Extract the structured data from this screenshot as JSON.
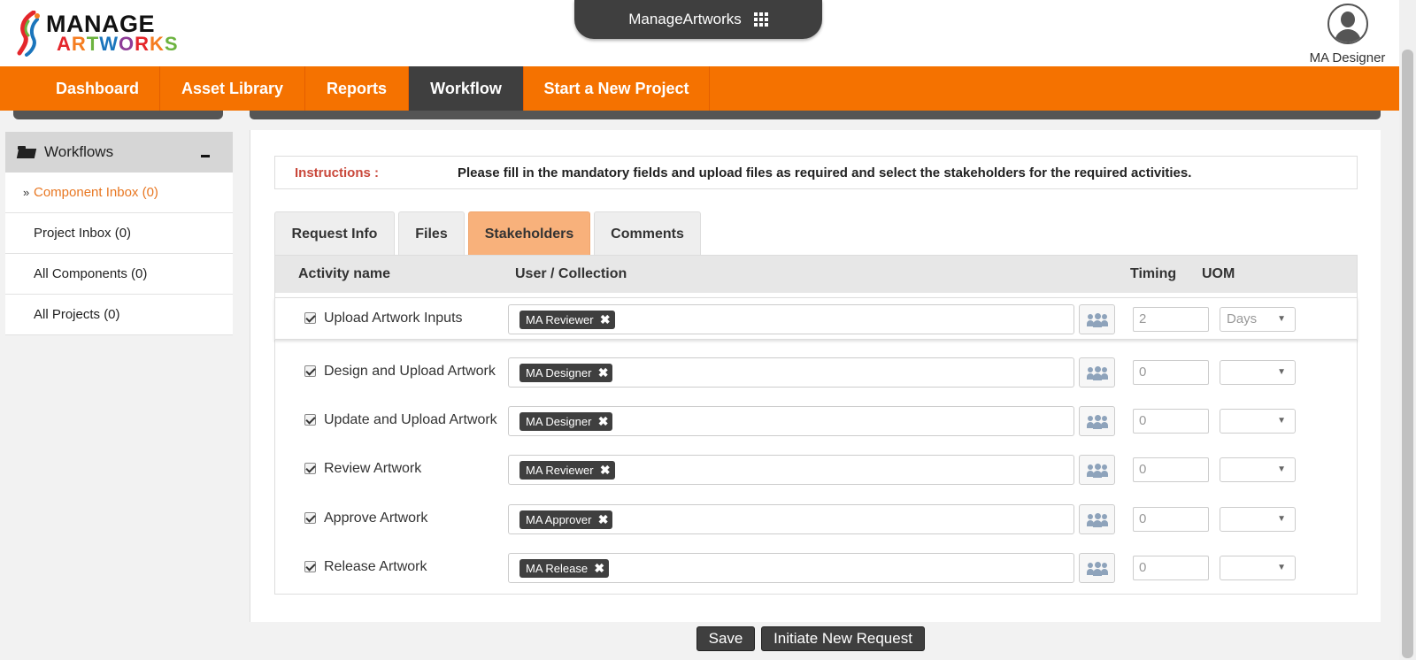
{
  "header": {
    "logo_line1": "MANAGE",
    "logo_line2_letters": [
      "A",
      "R",
      "T",
      "W",
      "O",
      "R",
      "K",
      "S"
    ],
    "logo_colors": [
      "#e4262b",
      "#f57d20",
      "#6cb33f",
      "#1b75bc",
      "#8e3c97",
      "#e4262b",
      "#f57d20",
      "#6cb33f"
    ],
    "app_name": "ManageArtworks",
    "user_name": "MA Designer"
  },
  "nav": {
    "items": [
      {
        "label": "Dashboard"
      },
      {
        "label": "Asset Library"
      },
      {
        "label": "Reports"
      },
      {
        "label": "Workflow",
        "active": true
      },
      {
        "label": "Start a New Project"
      }
    ]
  },
  "sidebar": {
    "header": "Workflows",
    "items": [
      {
        "label": "Component Inbox (0)",
        "active": true
      },
      {
        "label": "Project Inbox (0)"
      },
      {
        "label": "All Components (0)"
      },
      {
        "label": "All Projects (0)"
      }
    ]
  },
  "instructions": {
    "label": "Instructions :",
    "text": "Please fill in the mandatory fields and upload files as required and select the stakeholders for the required activities."
  },
  "tabs": [
    {
      "label": "Request Info"
    },
    {
      "label": "Files"
    },
    {
      "label": "Stakeholders",
      "active": true
    },
    {
      "label": "Comments"
    }
  ],
  "table": {
    "headers": {
      "activity": "Activity name",
      "user": "User / Collection",
      "timing": "Timing",
      "uom": "UOM"
    },
    "rows": [
      {
        "activity": "Upload Artwork Inputs",
        "user": "MA Reviewer",
        "timing": "2",
        "uom": "Days"
      },
      {
        "activity": "Design and Upload Artwork",
        "user": "MA Designer",
        "timing": "0",
        "uom": ""
      },
      {
        "activity": "Update and Upload Artwork",
        "user": "MA Designer",
        "timing": "0",
        "uom": ""
      },
      {
        "activity": "Review Artwork",
        "user": "MA Reviewer",
        "timing": "0",
        "uom": ""
      },
      {
        "activity": "Approve Artwork",
        "user": "MA Approver",
        "timing": "0",
        "uom": ""
      },
      {
        "activity": "Release Artwork",
        "user": "MA Release",
        "timing": "0",
        "uom": ""
      }
    ]
  },
  "actions": {
    "save": "Save",
    "initiate": "Initiate New Request"
  },
  "colors": {
    "accent": "#f57200",
    "dark": "#3f3f3f",
    "active_tab": "#f8b17b",
    "link_active": "#e87722",
    "instruction_label": "#c9483b"
  }
}
